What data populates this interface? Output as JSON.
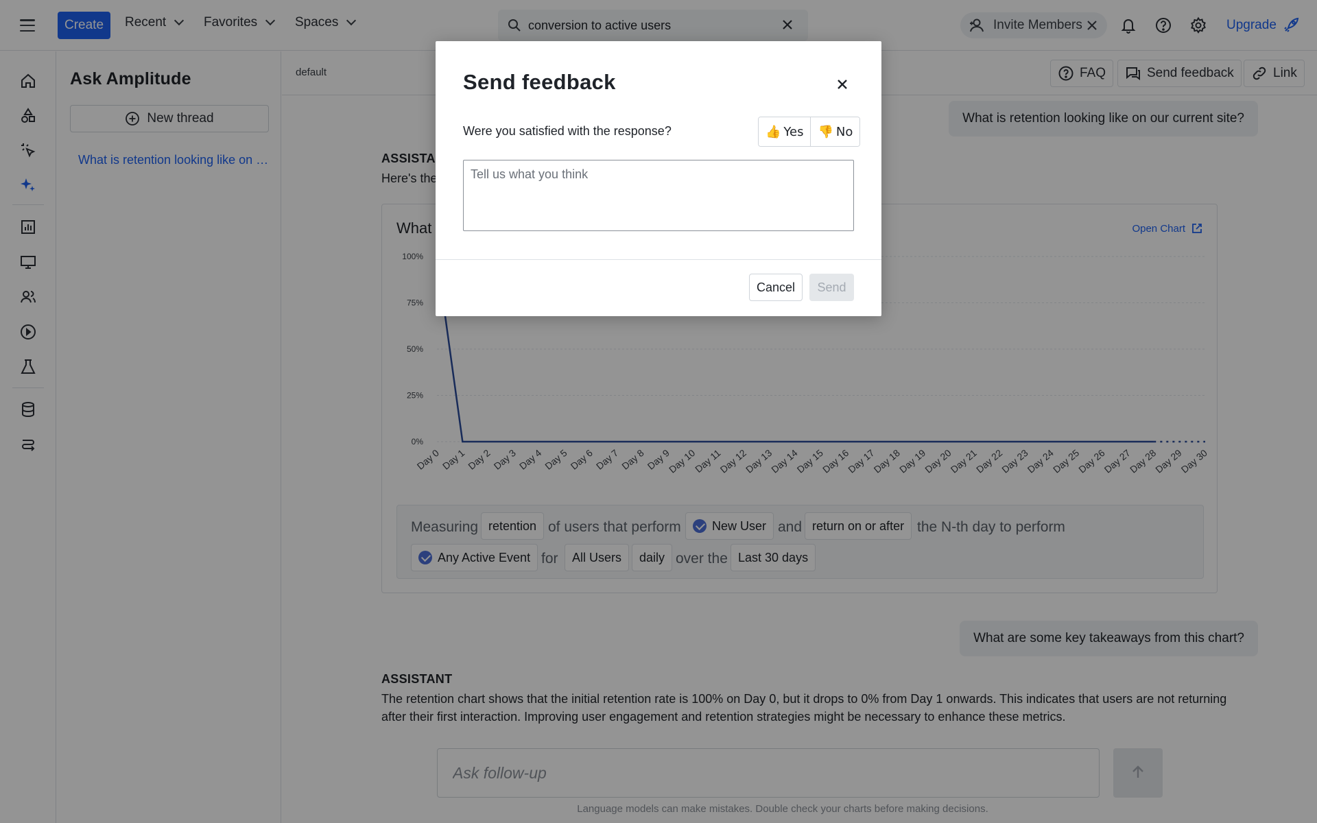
{
  "topbar": {
    "create_label": "Create",
    "recent_label": "Recent",
    "favorites_label": "Favorites",
    "spaces_label": "Spaces",
    "search_value": "conversion to active users",
    "invite_label": "Invite Members",
    "upgrade_label": "Upgrade"
  },
  "sidebar": {
    "title": "Ask Amplitude",
    "new_thread_label": "New thread",
    "threads": [
      "What is retention looking like on our current site?"
    ]
  },
  "main": {
    "workspace_label": "default",
    "faq_label": "FAQ",
    "send_feedback_label": "Send feedback",
    "link_label": "Link",
    "messages": {
      "q1": "What is retention looking like on our current site?",
      "assistant_label": "ASSISTANT",
      "a1_intro": "Here's the",
      "q2": "What are some key takeaways from this chart?",
      "a2": "The retention chart shows that the initial retention rate is 100% on Day 0, but it drops to 0% from Day 1 onwards. This indicates that users are not returning after their first interaction. Improving user engagement and retention strategies might be necessary to enhance these metrics."
    },
    "chart_card": {
      "title_visible": "What",
      "open_chart_label": "Open Chart"
    },
    "measure": {
      "measuring": "Measuring",
      "metric": "retention",
      "of_users": "of users that perform",
      "start_event": "New User",
      "and": "and",
      "condition": "return on or after",
      "nth_day": "the N-th day to perform",
      "return_event": "Any Active Event",
      "for": "for",
      "segment": "All Users",
      "interval": "daily",
      "over_the": "over the",
      "range": "Last 30 days"
    },
    "followup_placeholder": "Ask follow-up",
    "disclaimer": "Language models can make mistakes. Double check your charts before making decisions."
  },
  "modal": {
    "title": "Send feedback",
    "question": "Were you satisfied with the response?",
    "yes_label": "Yes",
    "yes_emoji": "👍",
    "no_label": "No",
    "no_emoji": "👎",
    "textarea_placeholder": "Tell us what you think",
    "cancel_label": "Cancel",
    "send_label": "Send"
  },
  "colors": {
    "accent": "#1e61f0",
    "line": "#2a4a9a",
    "overlay": "rgba(0,0,0,0.42)"
  },
  "chart_data": {
    "type": "line",
    "x": [
      "Day 0",
      "Day 1",
      "Day 2",
      "Day 3",
      "Day 4",
      "Day 5",
      "Day 6",
      "Day 7",
      "Day 8",
      "Day 9",
      "Day 10",
      "Day 11",
      "Day 12",
      "Day 13",
      "Day 14",
      "Day 15",
      "Day 16",
      "Day 17",
      "Day 18",
      "Day 19",
      "Day 20",
      "Day 21",
      "Day 22",
      "Day 23",
      "Day 24",
      "Day 25",
      "Day 26",
      "Day 27",
      "Day 28",
      "Day 29",
      "Day 30"
    ],
    "series": [
      {
        "values": [
          100,
          0,
          0,
          0,
          0,
          0,
          0,
          0,
          0,
          0,
          0,
          0,
          0,
          0,
          0,
          0,
          0,
          0,
          0,
          0,
          0,
          0,
          0,
          0,
          0,
          0,
          0,
          0,
          0,
          0,
          0
        ]
      }
    ],
    "yticks": [
      "100%",
      "75%",
      "50%",
      "25%",
      "0%"
    ],
    "ylim": [
      0,
      100
    ],
    "incomplete_from_index": 28,
    "grid": true
  }
}
